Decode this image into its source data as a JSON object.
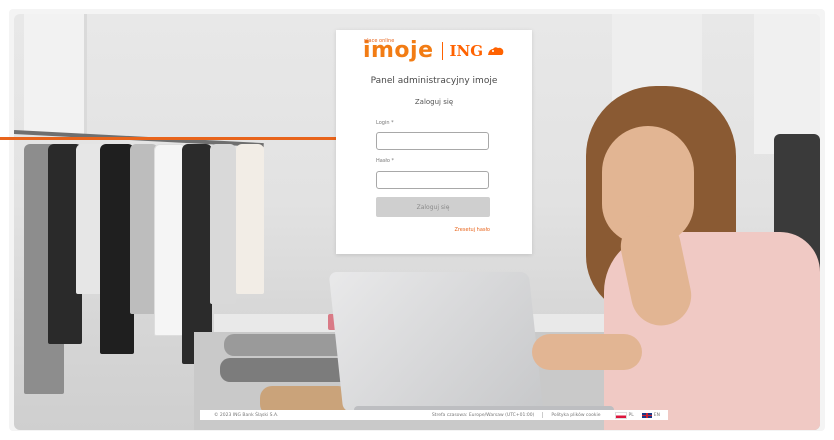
{
  "brand": {
    "tagline": "płace online",
    "product": "imoje",
    "bank": "ING",
    "colors": {
      "orange": "#f27c14",
      "ing_orange": "#ff6200",
      "arrow": "#e8641b"
    }
  },
  "login": {
    "title": "Panel administracyjny imoje",
    "subtitle": "Zaloguj się",
    "login_label": "Login *",
    "password_label": "Hasło *",
    "submit_label": "Zaloguj się",
    "forgot_label": "Zresetuj hasło",
    "login_value": "",
    "password_value": ""
  },
  "footer": {
    "copyright": "© 2023 ING Bank Śląski S.A.",
    "timezone": "Strefa czasowa: Europe/Warsaw (UTC+01:00)",
    "cookies": "Polityka plików cookie",
    "lang_pl": "PL",
    "lang_en": "EN"
  },
  "icons": {
    "arrow": "arrow-right-icon",
    "lion": "ing-lion-icon",
    "flag_pl": "flag-pl-icon",
    "flag_en": "flag-en-icon"
  }
}
